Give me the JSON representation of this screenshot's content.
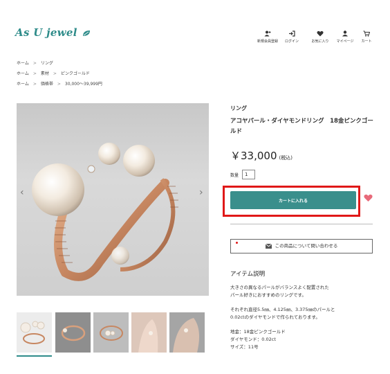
{
  "header": {
    "logo_text": "As U jewel",
    "nav": [
      {
        "icon": "user-plus-icon",
        "label": "新規会員登録"
      },
      {
        "icon": "login-icon",
        "label": "ログイン"
      },
      {
        "icon": "heart-icon",
        "label": "お気に入り"
      },
      {
        "icon": "user-icon",
        "label": "マイページ"
      },
      {
        "icon": "cart-icon",
        "label": "カート"
      }
    ]
  },
  "breadcrumbs": [
    {
      "items": [
        "ホーム",
        "リング"
      ]
    },
    {
      "items": [
        "ホーム",
        "素材",
        "ピンクゴールド"
      ]
    },
    {
      "items": [
        "ホーム",
        "価格帯",
        "30,000〜39,999円"
      ]
    }
  ],
  "breadcrumb_separator": ">",
  "gallery": {
    "prev_arrow": "‹",
    "next_arrow": "›"
  },
  "product": {
    "category": "リング",
    "title": "アコヤパール・ダイヤモンドリング　18金ピンクゴールド",
    "price": "￥33,000",
    "tax_note": "(税込)",
    "qty_label": "数量",
    "qty_value": "1",
    "cart_button": "カートに入れる",
    "inquiry_button": "この商品について問い合わせる"
  },
  "description": {
    "heading": "アイテム説明",
    "para1_line1": "大きさの異なるパールがバランスよく配置された",
    "para1_line2": "パール好きにおすすめのリングです。",
    "para2_line1": "それぞれ直径5.5㎜、4.125㎜、3.375㎜のパールと",
    "para2_line2": "0.02ctのダイヤモンドで作られております。",
    "spec1": "地金：18金ピンクゴールド",
    "spec2": "ダイヤモンド：0.02ct",
    "spec3": "サイズ：11号"
  },
  "colors": {
    "accent": "#3a8f8c",
    "highlight": "#e01818",
    "heart": "#e86a7a"
  }
}
